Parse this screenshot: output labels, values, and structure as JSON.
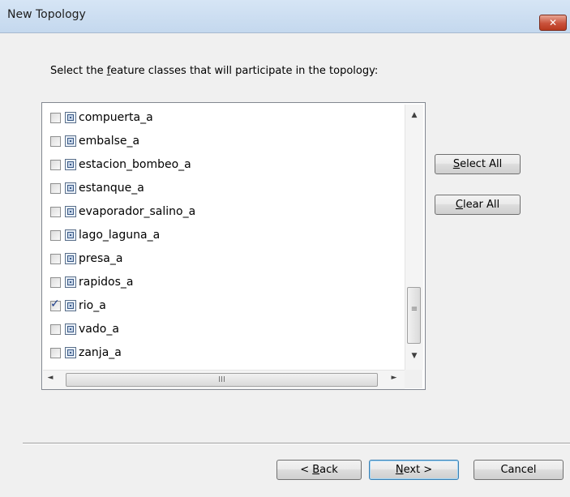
{
  "window": {
    "title": "New Topology",
    "close_glyph": "✕"
  },
  "prompt": {
    "before": "Select the ",
    "accel": "f",
    "after": "eature classes that will participate in the topology:"
  },
  "list": {
    "items": [
      {
        "label": "compuerta_a",
        "checked": false
      },
      {
        "label": "embalse_a",
        "checked": false
      },
      {
        "label": "estacion_bombeo_a",
        "checked": false
      },
      {
        "label": "estanque_a",
        "checked": false
      },
      {
        "label": "evaporador_salino_a",
        "checked": false
      },
      {
        "label": "lago_laguna_a",
        "checked": false
      },
      {
        "label": "presa_a",
        "checked": false
      },
      {
        "label": "rapidos_a",
        "checked": false
      },
      {
        "label": "rio_a",
        "checked": true
      },
      {
        "label": "vado_a",
        "checked": false
      },
      {
        "label": "zanja_a",
        "checked": false
      }
    ],
    "check_glyph": "✓",
    "scroll_up": "▲",
    "scroll_down": "▼",
    "scroll_left": "◄",
    "scroll_right": "►",
    "vgrip": "≡",
    "hgrip": "III"
  },
  "buttons": {
    "select_all": {
      "accel": "S",
      "rest": "elect All"
    },
    "clear_all": {
      "accel": "C",
      "rest": "lear All"
    },
    "back": {
      "pre": "< ",
      "accel": "B",
      "rest": "ack"
    },
    "next": {
      "accel": "N",
      "rest": "ext >"
    },
    "cancel": "Cancel"
  },
  "colors": {
    "close_button": "#c9523b",
    "default_button_border": "#3c7fb1",
    "titlebar": "#d6e5f5"
  }
}
